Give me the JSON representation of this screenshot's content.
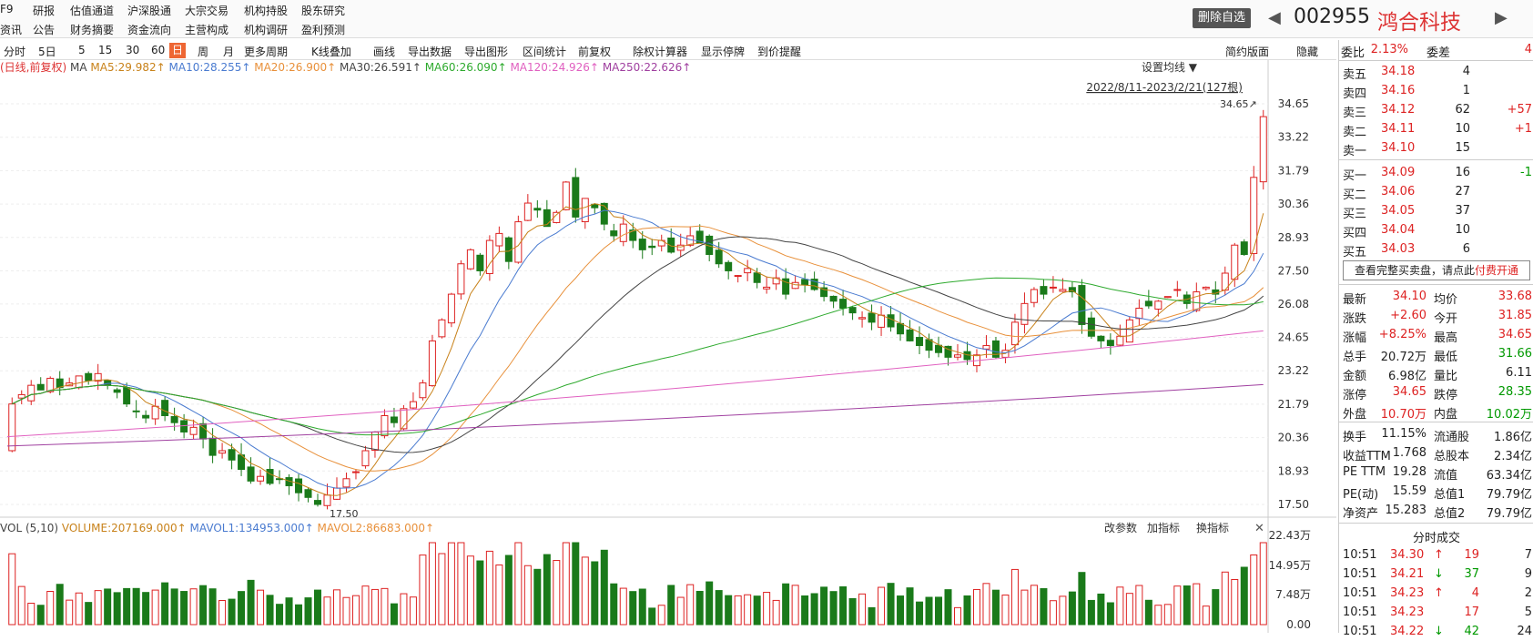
{
  "topnav": {
    "row1": [
      "F9",
      "研报",
      "估值通道",
      "沪深股通",
      "大宗交易",
      "机构持股",
      "股东研究"
    ],
    "row2": [
      "资讯",
      "公告",
      "财务摘要",
      "资金流向",
      "主营构成",
      "机构调研",
      "盈利预测"
    ],
    "remove_fav": "删除自选",
    "code": "002955",
    "name": "鸿合科技",
    "prev": "◀",
    "next": "▶"
  },
  "toolbar": {
    "items": [
      "分时",
      "5日",
      "5",
      "15",
      "30",
      "60",
      "日",
      "周",
      "月",
      "更多周期",
      "K线叠加",
      "画线",
      "导出数据",
      "导出图形",
      "区间统计",
      "前复权",
      "除权计算器",
      "显示停牌",
      "到价提醒"
    ],
    "right": [
      "简约版面",
      "隐藏"
    ]
  },
  "ma_legend": {
    "prefix": "(日线,前复权)",
    "items": [
      {
        "label": "MA",
        "color": "#444"
      },
      {
        "label": "MA5:29.982↑",
        "color": "#c8821a"
      },
      {
        "label": "MA10:28.255↑",
        "color": "#4a7bd0"
      },
      {
        "label": "MA20:26.900↑",
        "color": "#e8903a"
      },
      {
        "label": "MA30:26.591↑",
        "color": "#444"
      },
      {
        "label": "MA60:26.090↑",
        "color": "#2eaa2e"
      },
      {
        "label": "MA120:24.926↑",
        "color": "#e060c0"
      },
      {
        "label": "MA250:22.626↑",
        "color": "#a040a0"
      }
    ],
    "setting": "设置均线 ▼",
    "range": "2022/8/11-2023/2/21(127根)"
  },
  "yticks": [
    "34.65",
    "33.22",
    "31.79",
    "30.36",
    "28.93",
    "27.50",
    "26.08",
    "24.65",
    "23.22",
    "21.79",
    "20.36",
    "18.93",
    "17.50"
  ],
  "max_label": "34.65↗",
  "min_label": "17.50",
  "vol_legend": {
    "items": [
      {
        "label": "VOL (5,10)",
        "color": "#444"
      },
      {
        "label": "VOLUME:207169.000↑",
        "color": "#c8821a"
      },
      {
        "label": "MAVOL1:134953.000↑",
        "color": "#4a7bd0"
      },
      {
        "label": "MAVOL2:86683.000↑",
        "color": "#e8903a"
      }
    ],
    "buttons": [
      "改参数",
      "加指标",
      "换指标"
    ],
    "close": "✕"
  },
  "vol_yticks": [
    "22.43万",
    "14.95万",
    "7.48万",
    "0.00"
  ],
  "orderbook": {
    "webi": {
      "label": "委比",
      "value": "2.13%"
    },
    "weicha": {
      "label": "委差",
      "value": "4"
    },
    "asks": [
      {
        "label": "卖五",
        "price": "34.18",
        "vol": "4",
        "chg": ""
      },
      {
        "label": "卖四",
        "price": "34.16",
        "vol": "1",
        "chg": ""
      },
      {
        "label": "卖三",
        "price": "34.12",
        "vol": "62",
        "chg": "+57"
      },
      {
        "label": "卖二",
        "price": "34.11",
        "vol": "10",
        "chg": "+1"
      },
      {
        "label": "卖一",
        "price": "34.10",
        "vol": "15",
        "chg": ""
      }
    ],
    "bids": [
      {
        "label": "买一",
        "price": "34.09",
        "vol": "16",
        "chg": "-1"
      },
      {
        "label": "买二",
        "price": "34.06",
        "vol": "27",
        "chg": ""
      },
      {
        "label": "买三",
        "price": "34.05",
        "vol": "37",
        "chg": ""
      },
      {
        "label": "买四",
        "price": "34.04",
        "vol": "10",
        "chg": ""
      },
      {
        "label": "买五",
        "price": "34.03",
        "vol": "6",
        "chg": ""
      }
    ],
    "full_btn_text": "查看完整买卖盘，请点此",
    "full_btn_link": "付费开通"
  },
  "quote": [
    [
      "最新",
      "34.10",
      "均价",
      "33.68"
    ],
    [
      "涨跌",
      "+2.60",
      "今开",
      "31.85"
    ],
    [
      "涨幅",
      "+8.25%",
      "最高",
      "34.65"
    ],
    [
      "总手",
      "20.72万",
      "最低",
      "31.66"
    ],
    [
      "金额",
      "6.98亿",
      "量比",
      "6.11"
    ],
    [
      "涨停",
      "34.65",
      "跌停",
      "28.35"
    ],
    [
      "外盘",
      "10.70万",
      "内盘",
      "10.02万"
    ]
  ],
  "stats": [
    [
      "换手",
      "11.15%",
      "流通股",
      "1.86亿"
    ],
    [
      "收益TTM",
      "1.768",
      "总股本",
      "2.34亿"
    ],
    [
      "PE TTM",
      "19.28",
      "流值",
      "63.34亿"
    ],
    [
      "PE(动)",
      "15.59",
      "总值1",
      "79.79亿"
    ],
    [
      "净资产",
      "15.283",
      "总值2",
      "79.79亿"
    ]
  ],
  "trades_title": "分时成交",
  "trades": [
    [
      "10:51",
      "34.30",
      "↑",
      "19",
      "7"
    ],
    [
      "10:51",
      "34.21",
      "↓",
      "37",
      "9"
    ],
    [
      "10:51",
      "34.23",
      "↑",
      "4",
      "2"
    ],
    [
      "10:51",
      "34.23",
      "",
      "17",
      "5"
    ],
    [
      "10:51",
      "34.22",
      "↓",
      "42",
      "24"
    ]
  ],
  "chart_data": {
    "type": "candlestick",
    "title": "",
    "ylim": [
      17.5,
      34.65
    ],
    "start": 19.8,
    "closes": [
      21.8,
      22.2,
      22.6,
      22.4,
      22.9,
      22.5,
      22.7,
      23.0,
      22.8,
      23.1,
      22.6,
      22.3,
      21.8,
      21.5,
      21.2,
      21.7,
      21.3,
      21.0,
      20.6,
      20.8,
      20.3,
      19.6,
      19.8,
      19.4,
      19.0,
      18.5,
      18.7,
      18.4,
      18.6,
      18.3,
      18.0,
      17.8,
      17.5,
      17.9,
      18.2,
      18.6,
      18.9,
      19.8,
      20.6,
      21.3,
      21.0,
      21.6,
      21.9,
      22.7,
      24.5,
      25.4,
      26.5,
      27.8,
      28.4,
      27.5,
      28.8,
      29.1,
      27.9,
      29.6,
      30.4,
      30.1,
      29.4,
      30.0,
      31.3,
      29.8,
      30.6,
      30.2,
      29.5,
      29.0,
      29.5,
      28.8,
      28.4,
      28.5,
      28.8,
      28.3,
      28.6,
      29.0,
      28.7,
      28.2,
      27.8,
      27.5,
      27.3,
      27.6,
      27.0,
      26.8,
      27.2,
      26.5,
      27.0,
      26.9,
      26.7,
      26.4,
      26.2,
      25.9,
      25.7,
      25.5,
      25.3,
      25.6,
      25.1,
      24.8,
      24.5,
      24.3,
      24.1,
      24.0,
      23.8,
      23.9,
      23.7,
      23.9,
      24.3,
      23.8,
      24.1,
      25.3,
      26.1,
      26.7,
      26.5,
      26.8,
      26.7,
      26.6,
      25.2,
      24.7,
      24.5,
      24.3,
      24.7,
      25.4,
      25.9,
      26.0,
      26.2,
      26.4,
      26.7,
      26.1,
      26.6,
      26.8,
      26.5,
      27.4,
      28.6,
      28.2,
      31.5,
      34.1
    ]
  },
  "volume_data": {
    "ylim": [
      0,
      224300
    ],
    "unit": "shares"
  }
}
